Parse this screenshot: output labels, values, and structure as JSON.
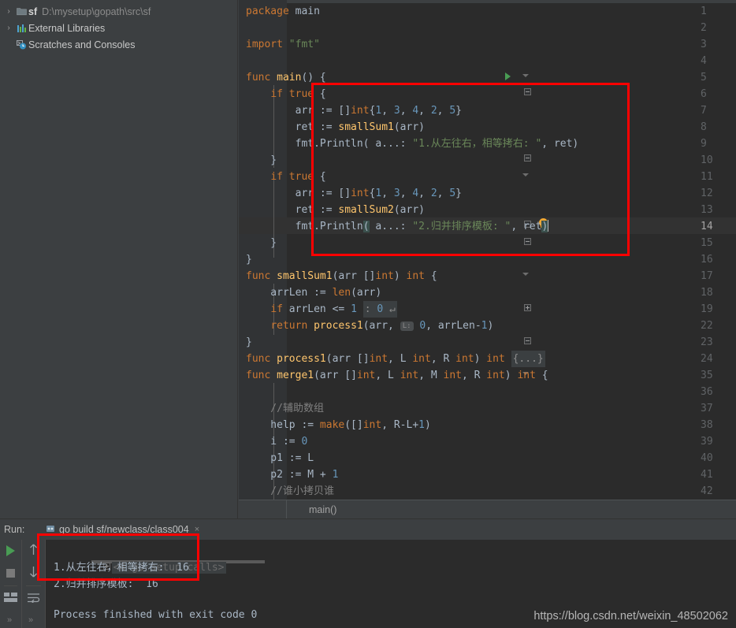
{
  "sidebar": {
    "items": [
      {
        "icon": "folder-icon",
        "arrow": "›",
        "name": "sf",
        "path": "D:\\mysetup\\gopath\\src\\sf"
      },
      {
        "icon": "library-bars-icon",
        "arrow": "›",
        "name": "External Libraries",
        "path": ""
      },
      {
        "icon": "scratches-icon",
        "arrow": "",
        "name": "Scratches and Consoles",
        "path": ""
      }
    ]
  },
  "editor": {
    "breadcrumb": "main()",
    "lines": [
      {
        "n": "1",
        "text": "package main"
      },
      {
        "n": "2",
        "text": ""
      },
      {
        "n": "3",
        "text": "import \"fmt\""
      },
      {
        "n": "4",
        "text": ""
      },
      {
        "n": "5",
        "text": "func main() {"
      },
      {
        "n": "6",
        "text": "    if true {"
      },
      {
        "n": "7",
        "text": "        arr := []int{1, 3, 4, 2, 5}"
      },
      {
        "n": "8",
        "text": "        ret := smallSum1(arr)"
      },
      {
        "n": "9",
        "text": "        fmt.Println( a...: \"1.从左往右，相等拷右: \", ret)"
      },
      {
        "n": "10",
        "text": "    }"
      },
      {
        "n": "11",
        "text": "    if true {"
      },
      {
        "n": "12",
        "text": "        arr := []int{1, 3, 4, 2, 5}"
      },
      {
        "n": "13",
        "text": "        ret := smallSum2(arr)"
      },
      {
        "n": "14",
        "text": "        fmt.Println( a...: \"2.归并排序模板: \", ret)"
      },
      {
        "n": "15",
        "text": "    }"
      },
      {
        "n": "16",
        "text": "}"
      },
      {
        "n": "17",
        "text": "func smallSum1(arr []int) int {"
      },
      {
        "n": "18",
        "text": "    arrLen := len(arr)"
      },
      {
        "n": "19",
        "text": "    if arrLen <= 1 : 0 ↵"
      },
      {
        "n": "22",
        "text": "    return process1(arr, L: 0, arrLen-1)"
      },
      {
        "n": "23",
        "text": "}"
      },
      {
        "n": "24",
        "text": "func process1(arr []int, L int, R int) int {...}"
      },
      {
        "n": "35",
        "text": "func merge1(arr []int, L int, M int, R int) int {"
      },
      {
        "n": "36",
        "text": ""
      },
      {
        "n": "37",
        "text": "    //辅助数组"
      },
      {
        "n": "38",
        "text": "    help := make([]int, R-L+1)"
      },
      {
        "n": "39",
        "text": "    i := 0"
      },
      {
        "n": "40",
        "text": "    p1 := L"
      },
      {
        "n": "41",
        "text": "    p2 := M + 1"
      },
      {
        "n": "42",
        "text": "    //谁小拷贝谁"
      }
    ],
    "hint_label": "a…:",
    "hint_label_L": "L:",
    "current_line": "14"
  },
  "run_panel": {
    "label": "Run:",
    "tab_title": "go build sf/newclass/class004",
    "tab_close": "×",
    "console_lines": [
      "<4 go setup calls>",
      "1.从左往右，相等拷右:  16",
      "2.归并排序模板:  16",
      "",
      "Process finished with exit code 0"
    ],
    "toolbar": {
      "rerun": "run-icon",
      "stop": "stop-icon",
      "layout": "layout-icon",
      "up": "↑",
      "down": "↓",
      "wrap": "soft-wrap-icon",
      "expand_left": "»",
      "expand_right": "»"
    }
  },
  "watermark": "https://blog.csdn.net/weixin_48502062",
  "colors": {
    "editor_bg": "#2b2b2b",
    "panel_bg": "#3c3f41",
    "gutter_bg": "#313335",
    "keyword": "#cc7832",
    "number": "#6897bb",
    "string": "#6a8759",
    "function": "#ffc66d",
    "comment": "#808080",
    "text": "#a9b7c6",
    "annotation_red": "#ff0000",
    "run_green": "#499c54"
  }
}
